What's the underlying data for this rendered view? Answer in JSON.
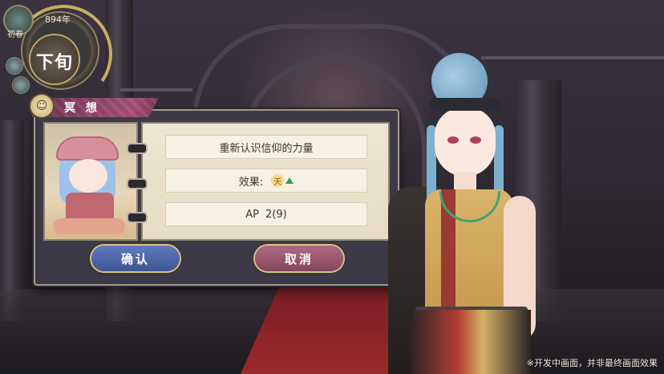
{
  "calendar": {
    "year": "894年",
    "period": "下旬",
    "season": "初春",
    "icons": [
      "sun-badge-icon",
      "settings-badge-icon"
    ]
  },
  "dialog": {
    "title": "冥 想",
    "title_icon": "meditation-icon",
    "rows": {
      "action": "重新认识信仰的力量",
      "effect_label": "效果:",
      "effect_badge": "天",
      "effect_icon": "up-arrow-icon",
      "ap_label": "AP",
      "ap_value": "2(9)"
    },
    "buttons": {
      "confirm": "确认",
      "cancel": "取消"
    }
  },
  "footer": {
    "disclaimer": "※开发中画面，并非最终画面效果"
  },
  "colors": {
    "confirm_button": "#4a66a8",
    "cancel_button": "#9b586c",
    "title_bar": "#a04d73",
    "effect_arrow": "#2f9a48"
  }
}
